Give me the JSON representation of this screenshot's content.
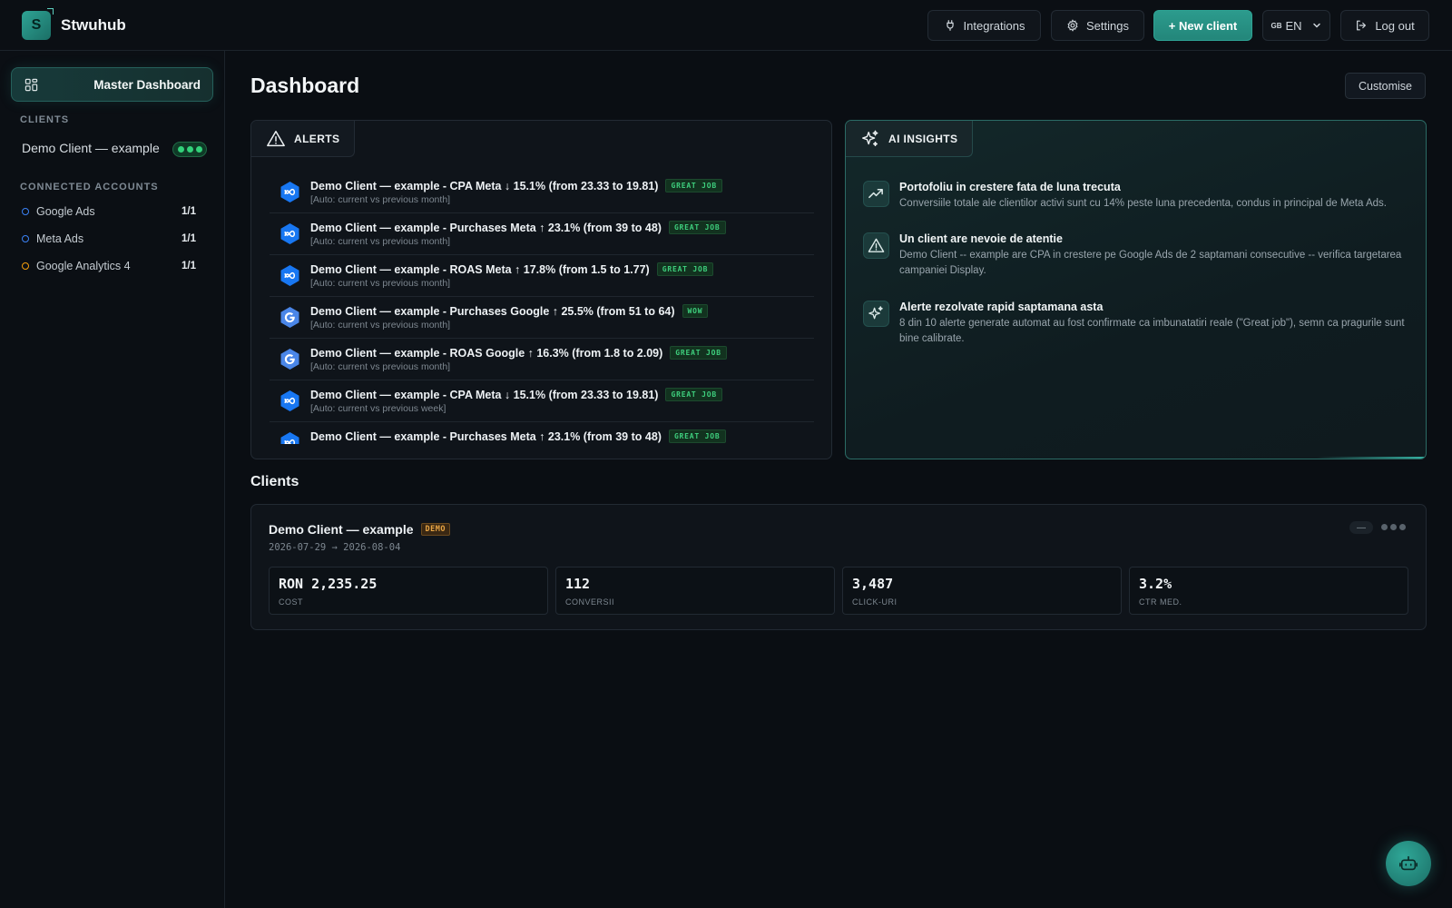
{
  "app": {
    "logo_letter": "S",
    "brand": "Stwuhub"
  },
  "header": {
    "integrations": "Integrations",
    "settings": "Settings",
    "new_client": "+ New client",
    "lang_flag": "GB",
    "lang": "EN",
    "logout": "Log out"
  },
  "sidebar": {
    "master": "Master Dashboard",
    "clients_label": "CLIENTS",
    "client": "Demo Client — example",
    "accounts_label": "CONNECTED ACCOUNTS",
    "accounts": [
      {
        "name": "Google Ads",
        "count": "1/1",
        "color": "#3b82f6"
      },
      {
        "name": "Meta Ads",
        "count": "1/1",
        "color": "#3b82f6"
      },
      {
        "name": "Google Analytics 4",
        "count": "1/1",
        "color": "#f59e0b"
      }
    ]
  },
  "main": {
    "title": "Dashboard",
    "customise": "Customise",
    "alerts": {
      "label": "ALERTS",
      "items": [
        {
          "icon": "meta-icon",
          "title": "Demo Client — example - CPA Meta ↓ 15.1% (from 23.33 to 19.81)",
          "tag": "GREAT JOB",
          "sub": "[Auto: current vs previous month]"
        },
        {
          "icon": "meta-icon",
          "title": "Demo Client — example - Purchases Meta ↑ 23.1% (from 39 to 48)",
          "tag": "GREAT JOB",
          "sub": "[Auto: current vs previous month]"
        },
        {
          "icon": "meta-icon",
          "title": "Demo Client — example - ROAS Meta ↑ 17.8% (from 1.5 to 1.77)",
          "tag": "GREAT JOB",
          "sub": "[Auto: current vs previous month]"
        },
        {
          "icon": "google-icon",
          "title": "Demo Client — example - Purchases Google ↑ 25.5% (from 51 to 64)",
          "tag": "WOW",
          "sub": "[Auto: current vs previous month]"
        },
        {
          "icon": "google-icon",
          "title": "Demo Client — example - ROAS Google ↑ 16.3% (from 1.8 to 2.09)",
          "tag": "GREAT JOB",
          "sub": "[Auto: current vs previous month]"
        },
        {
          "icon": "meta-icon",
          "title": "Demo Client — example - CPA Meta ↓ 15.1% (from 23.33 to 19.81)",
          "tag": "GREAT JOB",
          "sub": "[Auto: current vs previous week]"
        },
        {
          "icon": "meta-icon",
          "title": "Demo Client — example - Purchases Meta ↑ 23.1% (from 39 to 48)",
          "tag": "GREAT JOB",
          "sub": ""
        }
      ]
    },
    "insights": {
      "label": "AI INSIGHTS",
      "items": [
        {
          "icon": "trending-up-icon",
          "title": "Portofoliu in crestere fata de luna trecuta",
          "text": "Conversiile totale ale clientilor activi sunt cu 14% peste luna precedenta, condus in principal de Meta Ads."
        },
        {
          "icon": "warning-icon",
          "title": "Un client are nevoie de atentie",
          "text": "Demo Client -- example are CPA in crestere pe Google Ads de 2 saptamani consecutive -- verifica targetarea campaniei Display."
        },
        {
          "icon": "sparkle-icon",
          "title": "Alerte rezolvate rapid saptamana asta",
          "text": "8 din 10 alerte generate automat au fost confirmate ca imbunatatiri reale (\"Great job\"), semn ca pragurile sunt bine calibrate."
        }
      ]
    },
    "clients_title": "Clients",
    "client_card": {
      "name": "Demo Client — example",
      "tag": "DEMO",
      "date_range": "2026-07-29 → 2026-08-04",
      "status": "—",
      "metrics": [
        {
          "value": "RON 2,235.25",
          "label": "COST"
        },
        {
          "value": "112",
          "label": "CONVERSII"
        },
        {
          "value": "3,487",
          "label": "CLICK-URI"
        },
        {
          "value": "3.2%",
          "label": "CTR MED."
        }
      ]
    }
  }
}
